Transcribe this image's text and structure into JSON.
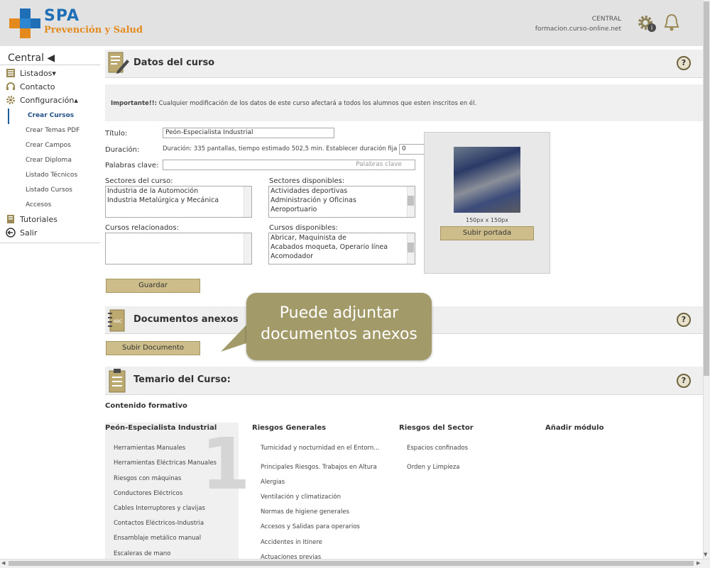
{
  "header": {
    "brand_main": "SPA",
    "brand_sub": "Prevención y Salud",
    "user_center": "CENTRAL",
    "domain": "formacion.curso-online.net"
  },
  "sidebar": {
    "title": "Central ◀",
    "items": [
      {
        "label": "Listados▾",
        "icon": "list-icon"
      },
      {
        "label": "Contacto",
        "icon": "headset-icon"
      },
      {
        "label": "Configuración▴",
        "icon": "gear-icon"
      }
    ],
    "sub_items": [
      "Crear Cursos",
      "Crear Temas PDF",
      "Crear Campos",
      "Crear Diploma",
      "Listado Técnicos",
      "Listado Cursos",
      "Accesos"
    ],
    "bottom_items": [
      {
        "label": "Tutoriales",
        "icon": "book-icon"
      },
      {
        "label": "Salir",
        "icon": "exit-icon"
      }
    ]
  },
  "course": {
    "section_title": "Datos del curso",
    "warning_strong": "Importante!!:",
    "warning_text": " Cualquier modificación de los datos de este curso afectará a todos los alumnos que esten inscritos en él.",
    "titulo_label": "Título:",
    "titulo_value": "Peón-Especialista Industrial",
    "duracion_label": "Duración:",
    "duracion_text": "Duración: 335 pantallas, tiempo estimado 502,5 min. Establecer duración fija",
    "duracion_value": "0",
    "palabras_label": "Palabras clave:",
    "palabras_placeholder": "Palabras clave",
    "sectores_curso_label": "Sectores del curso:",
    "sectores_curso": [
      "Industria de la Automoción",
      "Industria Metalúrgica y Mecánica"
    ],
    "sectores_disp_label": "Sectores disponibles:",
    "sectores_disp": [
      "Actividades deportivas",
      "Administración y Oficinas",
      "Aeroportuario"
    ],
    "cursos_rel_label": "Cursos relacionados:",
    "cursos_disp_label": "Cursos disponibles:",
    "cursos_disp": [
      "Abricar, Maquinista de",
      "Acabados moqueta, Operario línea",
      "Acomodador"
    ],
    "photo_size": "150px x 150px",
    "upload_cover": "Subir portada",
    "save": "Guardar"
  },
  "documents": {
    "section_title": "Documentos anexos",
    "upload": "Subir Documento"
  },
  "callout": {
    "line1": "Puede adjuntar",
    "line2": "documentos anexos"
  },
  "syllabus": {
    "section_title": "Temario del Curso:",
    "content_label": "Contenido formativo",
    "module_number": "1",
    "columns": [
      {
        "title": "Peón-Especialista Industrial",
        "items": [
          "Herramientas Manuales",
          "Herramientas Eléctricas Manuales",
          "Riesgos con máquinas",
          "Conductores Eléctricos",
          "Cables Interruptores y clavijas",
          "Contactos Eléctricos-Industria",
          "Ensamblaje metálico manual",
          "Escaleras de mano"
        ]
      },
      {
        "title": "Riesgos Generales",
        "items": [
          "Turnicidad y nocturnidad en el Entorn...",
          "Principales Riesgos. Trabajos en Altura",
          "Alergias",
          "Ventilación y climatización",
          "Normas de higiene generales",
          "Accesos y Salidas para operarios",
          "Accidentes in Itinere",
          "Actuaciones previas"
        ]
      },
      {
        "title": "Riesgos del Sector",
        "items": [
          "Espacios confinados",
          "Orden y Limpieza"
        ]
      },
      {
        "title": "Añadir módulo",
        "items": []
      }
    ]
  },
  "help_symbol": "?",
  "colors": {
    "accent": "#cdbd8a",
    "brand_blue": "#1f6fb7",
    "brand_orange": "#e48a1d",
    "callout": "#a39a6a"
  }
}
